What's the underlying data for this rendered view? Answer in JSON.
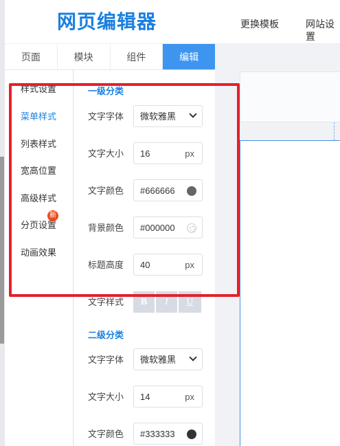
{
  "header": {
    "logo": "网页编辑器",
    "nav": [
      "更换模板",
      "网站设置"
    ]
  },
  "tabs": [
    {
      "label": "页面",
      "active": false
    },
    {
      "label": "模块",
      "active": false
    },
    {
      "label": "组件",
      "active": false
    },
    {
      "label": "编辑",
      "active": true
    }
  ],
  "sidebar": {
    "items": [
      {
        "label": "样式设置",
        "active": false
      },
      {
        "label": "菜单样式",
        "active": true
      },
      {
        "label": "列表样式",
        "active": false
      },
      {
        "label": "宽高位置",
        "active": false
      },
      {
        "label": "高级样式",
        "active": false
      },
      {
        "label": "分页设置",
        "active": false
      },
      {
        "label": "动画效果",
        "active": false
      }
    ],
    "new_badge": "新"
  },
  "panel": {
    "level1": {
      "title": "一级分类",
      "font_label": "文字字体",
      "font_value": "微软雅黑",
      "size_label": "文字大小",
      "size_value": "16",
      "size_unit": "px",
      "color_label": "文字颜色",
      "color_value": "#666666",
      "bg_label": "背景颜色",
      "bg_value": "#000000",
      "height_label": "标题高度",
      "height_value": "40",
      "height_unit": "px",
      "style_label": "文字样式",
      "style_buttons": [
        "B",
        "I",
        "U"
      ]
    },
    "level2": {
      "title": "二级分类",
      "font_label": "文字字体",
      "font_value": "微软雅黑",
      "size_label": "文字大小",
      "size_value": "14",
      "size_unit": "px",
      "color_label": "文字颜色",
      "color_value": "#333333"
    }
  },
  "colors": {
    "accent": "#1a7fe0",
    "active_tab": "#3d95f0",
    "highlight_box": "#e3202a",
    "badge": "#ee4b1d",
    "swatch_level1": "#666666",
    "swatch_level2": "#333333"
  }
}
